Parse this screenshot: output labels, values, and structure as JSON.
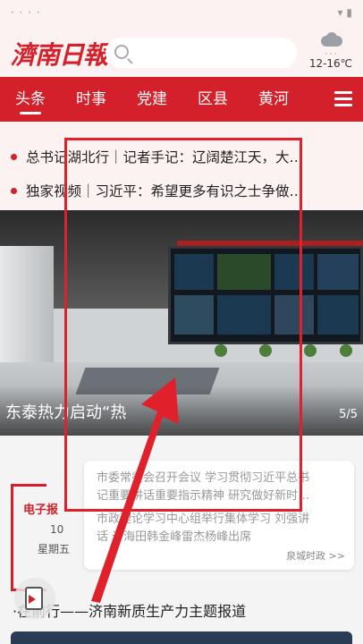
{
  "status_bar": {
    "left": "· · ·  ·",
    "right": "▾ ▮"
  },
  "header": {
    "logo": "濟南日報",
    "search_placeholder": "",
    "weather_icon": "cloud-rain-icon",
    "temperature": "12-16℃"
  },
  "nav": {
    "tabs": [
      "头条",
      "时事",
      "党建",
      "区县",
      "黄河"
    ],
    "active_index": 0,
    "menu_icon": "hamburger-menu-icon"
  },
  "headlines": [
    "总书记湖北行｜记者手记：辽阔楚江天，大…",
    "独家视频｜习近平：希望更多有识之士争做…"
  ],
  "banner": {
    "caption": "东泰热力启动“热",
    "counter": "5/5"
  },
  "epaper": {
    "title": "电子报",
    "day": "10",
    "weekday": "星期五"
  },
  "news_card": {
    "items": [
      [
        "市委常委会召开会议 学习贯彻习近平总书",
        "记重要讲话重要指示精神 研究做好新时…"
      ],
      [
        "市政理论学习中心组举行集体学习 刘强讲",
        "话 于海田韩金峰雷杰杨峰出席"
      ]
    ],
    "source": "泉城时政 >>"
  },
  "special_report": "·在前行——济南新质生产力主题报道",
  "annotation": {
    "color": "#e0202a"
  },
  "colors": {
    "brand": "#d3202a",
    "header_bg": "#fdf2f2"
  }
}
